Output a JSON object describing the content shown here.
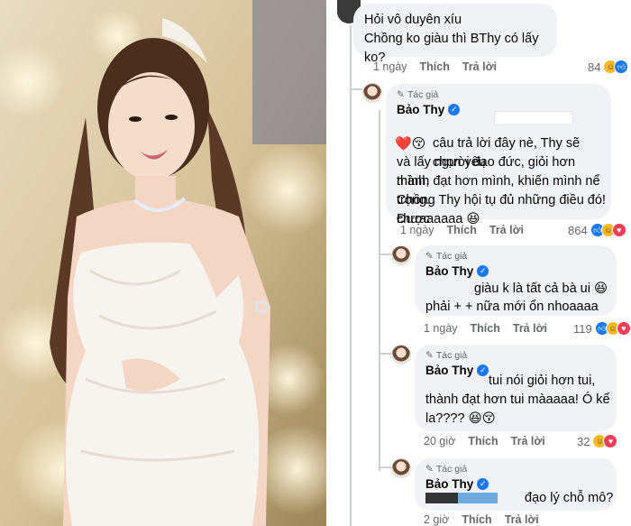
{
  "colors": {
    "accent": "#1877f2",
    "bubble": "#f0f2f5",
    "meta": "#65676b"
  },
  "labels": {
    "author_tag": "Tác giả",
    "author_name": "Bảo Thy",
    "like": "Thích",
    "reply": "Trả lời"
  },
  "comments": [
    {
      "lines": [
        "Hỏi vô duyên xíu",
        "Chồng ko giàu thì BThy có lấy ko?"
      ],
      "time": "1 ngày",
      "count": "84",
      "reactions": [
        "haha",
        "like"
      ]
    },
    {
      "lines": [
        "câu trả lời đây nè, Thy sẽ chọn yêu",
        "và lấy người đạo đức, giỏi hơn mình,",
        "thành đạt hơn mình, khiến mình nể trọng.",
        "Chồng Thy hội tụ đủ những điều đó! Được",
        "chưaaaaaa 😆"
      ],
      "lead_emoji": "❤️😚",
      "time": "1 ngày",
      "count": "864",
      "reactions": [
        "like",
        "haha",
        "love"
      ]
    },
    {
      "lines": [
        "giàu k là tất cả bà ui 😆",
        "phải + + nữa mới ổn nhoaaaa"
      ],
      "time": "1 ngày",
      "count": "119",
      "reactions": [
        "like",
        "haha",
        "love"
      ]
    },
    {
      "lines": [
        "tui nói giỏi hơn tui,",
        "thành đạt hơn tui màaaaa! Ó kể",
        "la???? 😆😚"
      ],
      "time": "20 giờ",
      "count": "32",
      "reactions": [
        "haha",
        "love"
      ]
    },
    {
      "lines": [
        "đạo lý chỗ mô?"
      ],
      "time": "2 giờ"
    }
  ]
}
